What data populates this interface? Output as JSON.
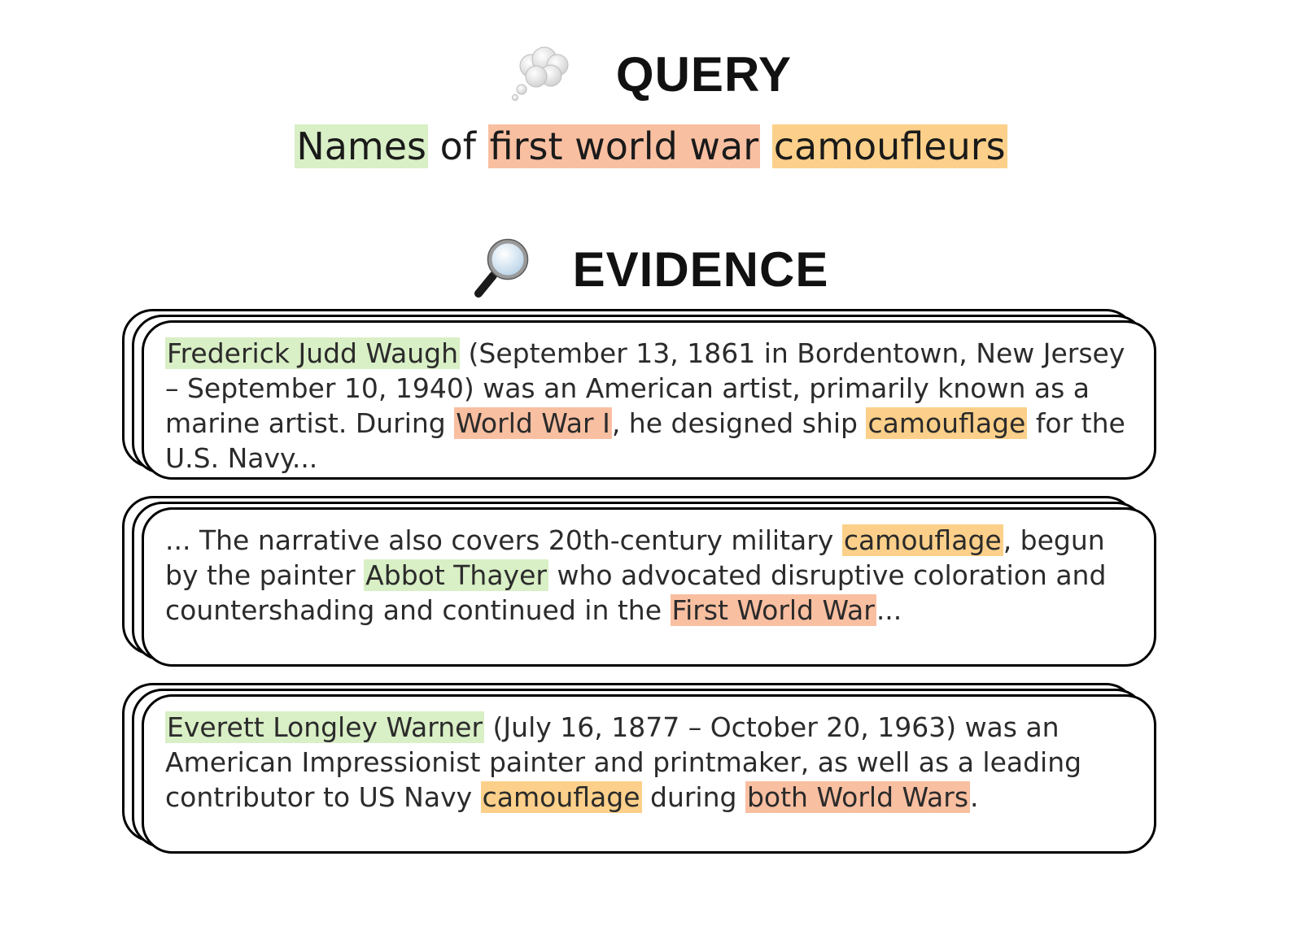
{
  "query": {
    "heading": "QUERY",
    "icon": "thought-bubble-icon",
    "segments": [
      {
        "text": "Names",
        "hl": "name"
      },
      {
        "text": " of ",
        "hl": ""
      },
      {
        "text": "first world war",
        "hl": "war"
      },
      {
        "text": " ",
        "hl": ""
      },
      {
        "text": "camoufleurs",
        "hl": "camo"
      }
    ]
  },
  "evidence": {
    "heading": "EVIDENCE",
    "icon": "magnifying-glass-icon",
    "passages": [
      {
        "segments": [
          {
            "text": "Frederick Judd Waugh",
            "hl": "name"
          },
          {
            "text": " (September 13, 1861 in Bordentown, New Jersey – September 10, 1940) was an American artist, primarily known as a marine artist. During ",
            "hl": ""
          },
          {
            "text": "World War I",
            "hl": "war"
          },
          {
            "text": ", he designed ship ",
            "hl": ""
          },
          {
            "text": "camouflage",
            "hl": "camo"
          },
          {
            "text": " for the U.S. Navy...",
            "hl": ""
          }
        ]
      },
      {
        "segments": [
          {
            "text": "... The narrative also covers 20th-century military ",
            "hl": ""
          },
          {
            "text": "camouflage",
            "hl": "camo"
          },
          {
            "text": ", begun by the painter ",
            "hl": ""
          },
          {
            "text": "Abbot Thayer",
            "hl": "name"
          },
          {
            "text": " who advocated disruptive coloration and countershading and continued in the ",
            "hl": ""
          },
          {
            "text": "First World War",
            "hl": "war"
          },
          {
            "text": "...",
            "hl": ""
          }
        ]
      },
      {
        "segments": [
          {
            "text": "Everett Longley Warner",
            "hl": "name"
          },
          {
            "text": " (July 16, 1877 – October 20, 1963) was an American Impressionist painter and printmaker, as well as a leading contributor to US Navy ",
            "hl": ""
          },
          {
            "text": "camouflage",
            "hl": "camo"
          },
          {
            "text": " during ",
            "hl": ""
          },
          {
            "text": "both World Wars",
            "hl": "war"
          },
          {
            "text": ".",
            "hl": ""
          }
        ]
      }
    ]
  },
  "highlight_colors": {
    "name": "#d9efc6",
    "war": "#f9bfa1",
    "camo": "#fcd08a"
  }
}
